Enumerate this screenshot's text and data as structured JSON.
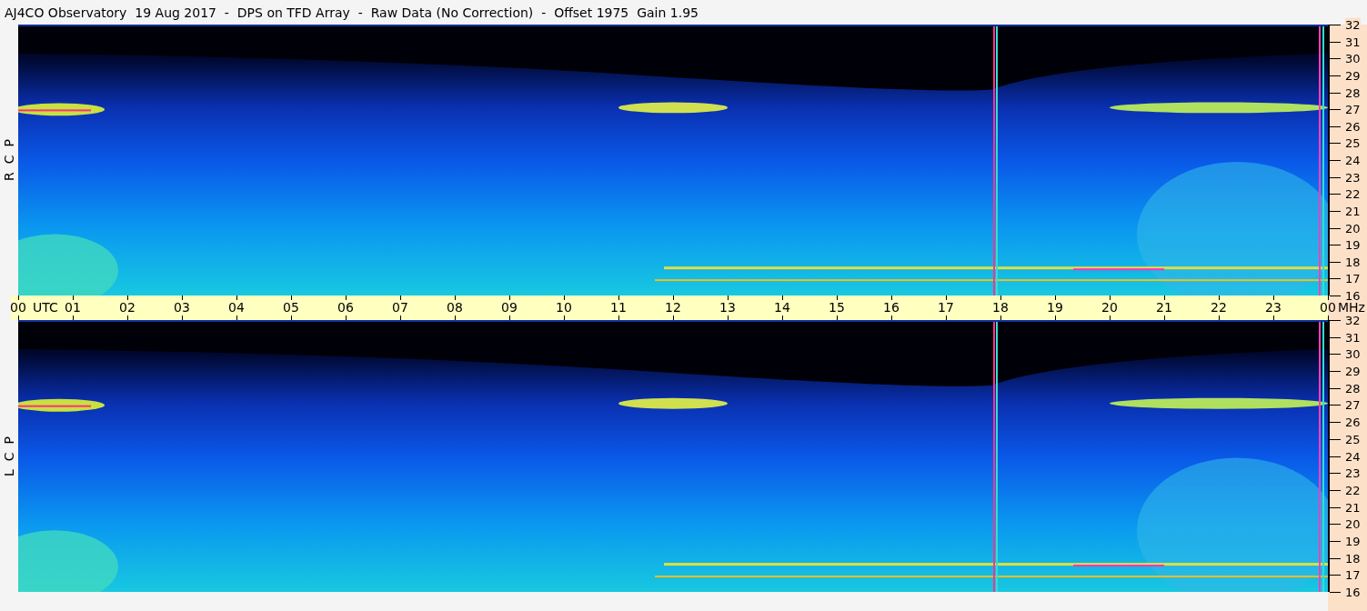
{
  "title": "AJ4CO Observatory  19 Aug 2017  -  DPS on TFD Array  -  Raw Data (No Correction)  -  Offset 1975  Gain 1.95",
  "panels": [
    {
      "polarization": "R  C  P",
      "frequency_ticks": [
        "32",
        "31",
        "30",
        "29",
        "28",
        "27",
        "26",
        "25",
        "24",
        "23",
        "22",
        "21",
        "20",
        "19",
        "18",
        "17",
        "16"
      ]
    },
    {
      "polarization": "L  C  P",
      "frequency_ticks": [
        "32",
        "31",
        "30",
        "29",
        "28",
        "27",
        "26",
        "25",
        "24",
        "23",
        "22",
        "21",
        "20",
        "19",
        "18",
        "17",
        "16"
      ]
    }
  ],
  "time_axis": {
    "ticks": [
      "00",
      "01",
      "02",
      "03",
      "04",
      "05",
      "06",
      "07",
      "08",
      "09",
      "10",
      "11",
      "12",
      "13",
      "14",
      "15",
      "16",
      "17",
      "18",
      "19",
      "20",
      "21",
      "22",
      "23",
      "00"
    ],
    "unit": "UTC",
    "frequency_unit": "MHz"
  }
}
